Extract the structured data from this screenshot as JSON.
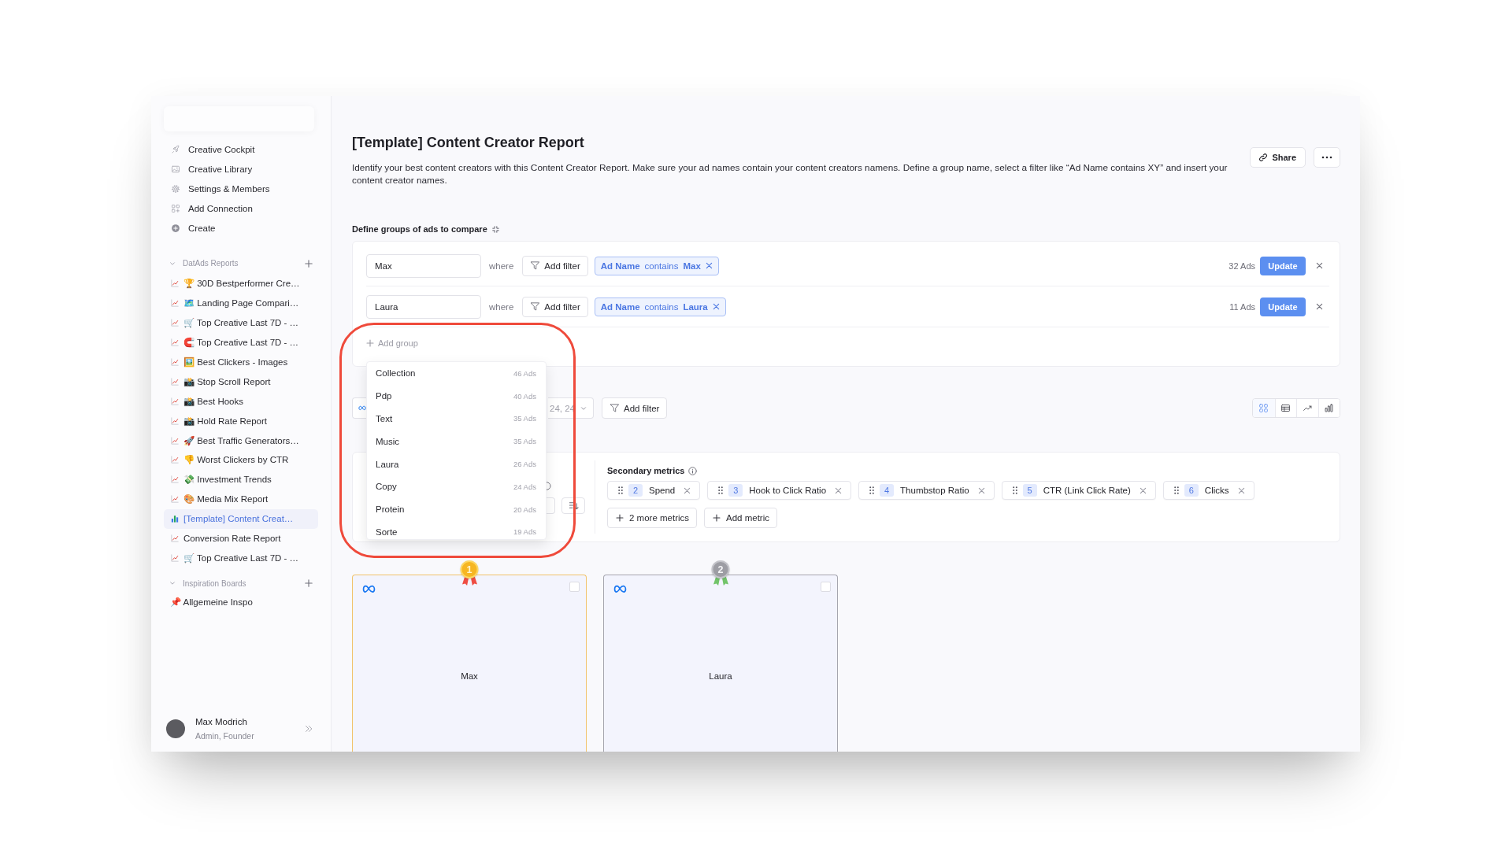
{
  "sidebar": {
    "nav_items": [
      {
        "label": "Creative Cockpit"
      },
      {
        "label": "Creative Library"
      },
      {
        "label": "Settings & Members"
      },
      {
        "label": "Add Connection"
      },
      {
        "label": "Create"
      }
    ],
    "sections": [
      {
        "title": "DatAds Reports",
        "kind": "reports",
        "expanded": true,
        "items": [
          {
            "label": "🏆 30D Bestperformer Cre…",
            "selected": false
          },
          {
            "label": "🗺️ Landing Page Compari…",
            "selected": false
          },
          {
            "label": "🛒 Top Creative Last 7D - …",
            "selected": false
          },
          {
            "label": "🧲 Top Creative Last 7D - …",
            "selected": false
          },
          {
            "label": "🖼️ Best Clickers - Images",
            "selected": false
          },
          {
            "label": "📸 Stop Scroll Report",
            "selected": false
          },
          {
            "label": "📸 Best Hooks",
            "selected": false
          },
          {
            "label": "📸 Hold Rate Report",
            "selected": false
          },
          {
            "label": "🚀 Best Traffic Generators…",
            "selected": false
          },
          {
            "label": "👎 Worst Clickers by CTR",
            "selected": false
          },
          {
            "label": "💸 Investment Trends",
            "selected": false
          },
          {
            "label": "🎨 Media Mix Report",
            "selected": false
          },
          {
            "label": "[Template] Content Creat…",
            "selected": true
          },
          {
            "label": "Conversion Rate Report",
            "selected": false
          },
          {
            "label": "🛒 Top Creative Last 7D - …",
            "selected": false
          }
        ]
      },
      {
        "title": "Inspiration Boards",
        "kind": "boards",
        "expanded": true,
        "items": [
          {
            "label": "📌 Allgemeine Inspo",
            "selected": false
          }
        ]
      }
    ],
    "user": {
      "name": "Max Modrich",
      "role": "Admin, Founder"
    }
  },
  "header": {
    "title": "[Template] Content Creator Report",
    "description": "Identify your best content creators with this Content Creator Report. Make sure your ad names contain your content creators namens. Define a group name, select a filter like “Ad Name contains XY” and insert your content creator names.",
    "share": "Share"
  },
  "groups": {
    "title": "Define groups of ads to compare",
    "rows": [
      {
        "name": "Max",
        "connector": "where",
        "add_filter": "Add filter",
        "filter": "**Ad Name** contains **Max**",
        "count": "32 Ads",
        "action": "Update"
      },
      {
        "name": "Laura",
        "connector": "where",
        "add_filter": "Add filter",
        "filter": "**Ad Name** contains **Laura**",
        "count": "11 Ads",
        "action": "Update"
      }
    ],
    "add_group": "Add group"
  },
  "group_menu": {
    "items": [
      {
        "label": "Collection",
        "count": "46 Ads"
      },
      {
        "label": "Pdp",
        "count": "40 Ads"
      },
      {
        "label": "Text",
        "count": "35 Ads"
      },
      {
        "label": "Music",
        "count": "35 Ads"
      },
      {
        "label": "Laura",
        "count": "26 Ads"
      },
      {
        "label": "Copy",
        "count": "24 Ads"
      },
      {
        "label": "Protein",
        "count": "20 Ads"
      },
      {
        "label": "Sorte",
        "count": "19 Ads"
      }
    ]
  },
  "toolbar": {
    "date": "24, 24",
    "add_filter": "Add filter",
    "views": [
      {
        "selected": true
      },
      {
        "selected": false
      },
      {
        "selected": false
      },
      {
        "selected": false
      }
    ]
  },
  "metrics": {
    "title": "Secondary metrics",
    "items": [
      {
        "index": "2",
        "label": "Spend"
      },
      {
        "index": "3",
        "label": "Hook to Click Ratio"
      },
      {
        "index": "4",
        "label": "Thumbstop Ratio"
      },
      {
        "index": "5",
        "label": "CTR (Link Click Rate)"
      },
      {
        "index": "6",
        "label": "Clicks"
      }
    ],
    "more": "2 more metrics",
    "add": "Add metric"
  },
  "cards": [
    {
      "name": "Max",
      "rank": "1",
      "kind": "gold",
      "checked": false
    },
    {
      "name": "Laura",
      "rank": "2",
      "kind": "silver",
      "checked": false
    }
  ]
}
